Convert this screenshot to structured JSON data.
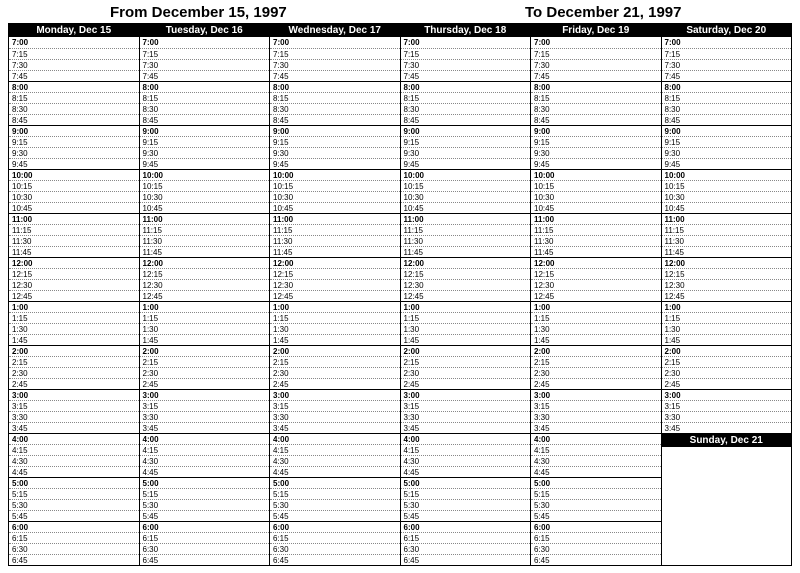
{
  "header": {
    "from_label": "From December 15, 1997",
    "to_label": "To December 21, 1997"
  },
  "days": [
    {
      "label": "Monday, Dec 15"
    },
    {
      "label": "Tuesday, Dec 16"
    },
    {
      "label": "Wednesday, Dec 17"
    },
    {
      "label": "Thursday, Dec 18"
    },
    {
      "label": "Friday, Dec 19"
    },
    {
      "label": "Saturday, Dec 20"
    }
  ],
  "sunday": {
    "label": "Sunday, Dec 21"
  },
  "time_slots_full": [
    "7:00",
    "7:15",
    "7:30",
    "7:45",
    "8:00",
    "8:15",
    "8:30",
    "8:45",
    "9:00",
    "9:15",
    "9:30",
    "9:45",
    "10:00",
    "10:15",
    "10:30",
    "10:45",
    "11:00",
    "11:15",
    "11:30",
    "11:45",
    "12:00",
    "12:15",
    "12:30",
    "12:45",
    "1:00",
    "1:15",
    "1:30",
    "1:45",
    "2:00",
    "2:15",
    "2:30",
    "2:45",
    "3:00",
    "3:15",
    "3:30",
    "3:45",
    "4:00",
    "4:15",
    "4:30",
    "4:45",
    "5:00",
    "5:15",
    "5:30",
    "5:45",
    "6:00",
    "6:15",
    "6:30",
    "6:45"
  ],
  "time_slots_saturday": [
    "7:00",
    "7:15",
    "7:30",
    "7:45",
    "8:00",
    "8:15",
    "8:30",
    "8:45",
    "9:00",
    "9:15",
    "9:30",
    "9:45",
    "10:00",
    "10:15",
    "10:30",
    "10:45",
    "11:00",
    "11:15",
    "11:30",
    "11:45",
    "12:00",
    "12:15",
    "12:30",
    "12:45",
    "1:00",
    "1:15",
    "1:30",
    "1:45",
    "2:00",
    "2:15",
    "2:30",
    "2:45",
    "3:00",
    "3:15",
    "3:30",
    "3:45"
  ]
}
